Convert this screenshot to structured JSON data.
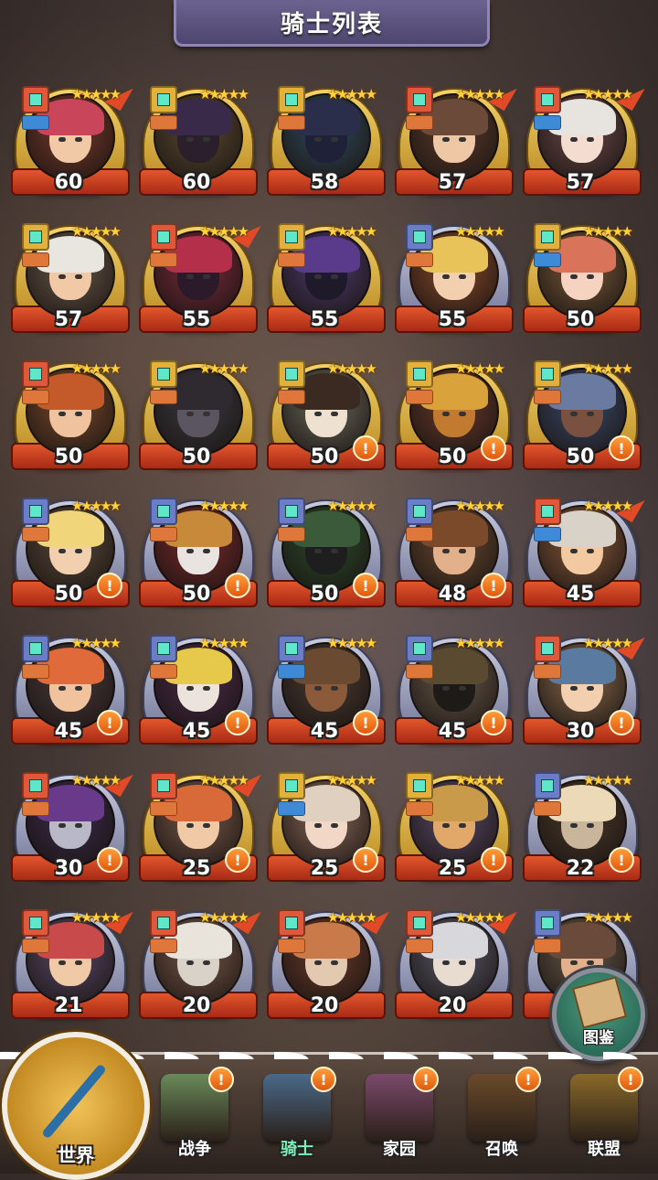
{
  "header": {
    "title": "骑士列表"
  },
  "knights": [
    {
      "level": "60",
      "frame": "gold",
      "tag": "t-red",
      "sub": "b-blue",
      "stars": "★★★★★",
      "up": true,
      "alert": false,
      "hair": "#c9455a",
      "skin": "#f1c9a6",
      "bg": "#7a3a2a"
    },
    {
      "level": "60",
      "frame": "gold",
      "tag": "t-gold",
      "sub": "b-orange",
      "stars": "★★★★★",
      "up": false,
      "alert": false,
      "hair": "#3a2a4a",
      "skin": "#2a1f2a",
      "bg": "#5b4a30"
    },
    {
      "level": "58",
      "frame": "gold",
      "tag": "t-gold",
      "sub": "b-orange",
      "stars": "★★★★★",
      "up": false,
      "alert": false,
      "hair": "#2a2e4a",
      "skin": "#1e2138",
      "bg": "#2e4a5a"
    },
    {
      "level": "57",
      "frame": "gold",
      "tag": "t-red",
      "sub": "b-orange",
      "stars": "★★★★★",
      "up": true,
      "alert": false,
      "hair": "#6b4a3a",
      "skin": "#eec7a5",
      "bg": "#5a3a2a"
    },
    {
      "level": "57",
      "frame": "gold",
      "tag": "t-red",
      "sub": "b-blue",
      "stars": "★★★★★",
      "up": true,
      "alert": false,
      "hair": "#e7e4df",
      "skin": "#f4ddd0",
      "bg": "#6b4a4a"
    },
    {
      "level": "57",
      "frame": "gold",
      "tag": "t-gold",
      "sub": "b-orange",
      "stars": "★★★★★",
      "up": false,
      "alert": false,
      "hair": "#e9e6e0",
      "skin": "#f1c9a6",
      "bg": "#6a5a4a"
    },
    {
      "level": "55",
      "frame": "gold",
      "tag": "t-red",
      "sub": "b-orange",
      "stars": "★★★★★",
      "up": true,
      "alert": false,
      "hair": "#b32f4a",
      "skin": "#2a1a2a",
      "bg": "#7a2a3a"
    },
    {
      "level": "55",
      "frame": "gold",
      "tag": "t-gold",
      "sub": "b-orange",
      "stars": "★★★★★",
      "up": false,
      "alert": false,
      "hair": "#5a3a8a",
      "skin": "#1e1a2a",
      "bg": "#4a3a6a"
    },
    {
      "level": "55",
      "frame": "silver",
      "tag": "t-blue",
      "sub": "b-orange",
      "stars": "★★★★★",
      "up": false,
      "alert": false,
      "hair": "#e8c35a",
      "skin": "#f2cfae",
      "bg": "#8a4a2a"
    },
    {
      "level": "50",
      "frame": "gold",
      "tag": "t-gold",
      "sub": "b-blue",
      "stars": "★★★★★",
      "up": false,
      "alert": false,
      "hair": "#d9745a",
      "skin": "#f6d3c0",
      "bg": "#7a5a3a"
    },
    {
      "level": "50",
      "frame": "gold",
      "tag": "t-red",
      "sub": "b-orange",
      "stars": "★★★★★",
      "up": false,
      "alert": false,
      "hair": "#c45a2a",
      "skin": "#f0c39e",
      "bg": "#7a4a2a"
    },
    {
      "level": "50",
      "frame": "gold",
      "tag": "t-gold",
      "sub": "b-orange",
      "stars": "★★★★★",
      "up": false,
      "alert": false,
      "hair": "#2e2a30",
      "skin": "#5a5560",
      "bg": "#3a3a40"
    },
    {
      "level": "50",
      "frame": "gold",
      "tag": "t-gold",
      "sub": "b-orange",
      "stars": "★★★★★",
      "up": false,
      "alert": true,
      "hair": "#3a2a22",
      "skin": "#efe1cf",
      "bg": "#6a6a5a"
    },
    {
      "level": "50",
      "frame": "gold",
      "tag": "t-gold",
      "sub": "b-orange",
      "stars": "★★★★★",
      "up": false,
      "alert": true,
      "hair": "#d9a23a",
      "skin": "#c27a30",
      "bg": "#6a3a2a"
    },
    {
      "level": "50",
      "frame": "gold",
      "tag": "t-gold",
      "sub": "b-orange",
      "stars": "★★★★★",
      "up": false,
      "alert": true,
      "hair": "#6a7aa0",
      "skin": "#7a5040",
      "bg": "#3a4a6a"
    },
    {
      "level": "50",
      "frame": "silver",
      "tag": "t-blue",
      "sub": "b-orange",
      "stars": "★★★★★",
      "up": false,
      "alert": true,
      "hair": "#f0d57a",
      "skin": "#f2cfae",
      "bg": "#5a4a3a"
    },
    {
      "level": "50",
      "frame": "silver",
      "tag": "t-blue",
      "sub": "b-orange",
      "stars": "★★★★★",
      "up": false,
      "alert": true,
      "hair": "#c78a3a",
      "skin": "#e9e4df",
      "bg": "#7a2a2a"
    },
    {
      "level": "50",
      "frame": "silver",
      "tag": "t-blue",
      "sub": "b-orange",
      "stars": "★★★★★",
      "up": false,
      "alert": true,
      "hair": "#3a5a3a",
      "skin": "#1e1e1e",
      "bg": "#2a4a2a"
    },
    {
      "level": "48",
      "frame": "silver",
      "tag": "t-blue",
      "sub": "b-orange",
      "stars": "★★★★★",
      "up": false,
      "alert": true,
      "hair": "#7a4a2a",
      "skin": "#e2b08a",
      "bg": "#6a4a30"
    },
    {
      "level": "45",
      "frame": "silver",
      "tag": "t-red",
      "sub": "b-blue",
      "stars": "★★★★★",
      "up": true,
      "alert": false,
      "hair": "#d8d2c8",
      "skin": "#f2c9a0",
      "bg": "#8a5a3a"
    },
    {
      "level": "45",
      "frame": "silver",
      "tag": "t-blue",
      "sub": "b-orange",
      "stars": "★★★★★",
      "up": false,
      "alert": true,
      "hair": "#e06a3a",
      "skin": "#f0c39e",
      "bg": "#4a3a3a"
    },
    {
      "level": "45",
      "frame": "silver",
      "tag": "t-blue",
      "sub": "b-orange",
      "stars": "★★★★★",
      "up": false,
      "alert": true,
      "hair": "#e6c84a",
      "skin": "#ece4dc",
      "bg": "#4a2a4a"
    },
    {
      "level": "45",
      "frame": "silver",
      "tag": "t-blue",
      "sub": "b-blue",
      "stars": "★★★★★",
      "up": false,
      "alert": true,
      "hair": "#6a4a30",
      "skin": "#8a5a3a",
      "bg": "#4a3a30"
    },
    {
      "level": "45",
      "frame": "silver",
      "tag": "t-blue",
      "sub": "b-orange",
      "stars": "★★★★★",
      "up": false,
      "alert": true,
      "hair": "#5a4a30",
      "skin": "#1e1a18",
      "bg": "#6a5a4a"
    },
    {
      "level": "30",
      "frame": "silver",
      "tag": "t-red",
      "sub": "b-orange",
      "stars": "★★★★★",
      "up": true,
      "alert": true,
      "hair": "#5a7aa0",
      "skin": "#f2cfae",
      "bg": "#8a6a4a"
    },
    {
      "level": "30",
      "frame": "silver",
      "tag": "t-red",
      "sub": "b-orange",
      "stars": "★★★★★",
      "up": true,
      "alert": true,
      "hair": "#6a3a8a",
      "skin": "#b8b8c8",
      "bg": "#3a2a4a"
    },
    {
      "level": "25",
      "frame": "gold",
      "tag": "t-red",
      "sub": "b-orange",
      "stars": "★★★★★",
      "up": true,
      "alert": true,
      "hair": "#d86a3a",
      "skin": "#f0c9a6",
      "bg": "#7a5a4a"
    },
    {
      "level": "25",
      "frame": "gold",
      "tag": "t-gold",
      "sub": "b-blue",
      "stars": "★★★★★",
      "up": false,
      "alert": true,
      "hair": "#e0d0c0",
      "skin": "#f2d6c6",
      "bg": "#8a6a5a"
    },
    {
      "level": "25",
      "frame": "gold",
      "tag": "t-gold",
      "sub": "b-orange",
      "stars": "★★★★★",
      "up": false,
      "alert": true,
      "hair": "#c89a4a",
      "skin": "#e1a86a",
      "bg": "#5a4a6a"
    },
    {
      "level": "22",
      "frame": "silver",
      "tag": "t-blue",
      "sub": "b-orange",
      "stars": "★★★★★",
      "up": false,
      "alert": true,
      "hair": "#ecd9b8",
      "skin": "#c9b59a",
      "bg": "#4a3a2a"
    },
    {
      "level": "21",
      "frame": "silver",
      "tag": "t-red",
      "sub": "b-orange",
      "stars": "★★★★★",
      "up": true,
      "alert": false,
      "hair": "#c84a4a",
      "skin": "#f0c9a6",
      "bg": "#5a4a6a"
    },
    {
      "level": "20",
      "frame": "silver",
      "tag": "t-red",
      "sub": "b-orange",
      "stars": "★★★★★",
      "up": true,
      "alert": false,
      "hair": "#e8e4dc",
      "skin": "#d9d2c9",
      "bg": "#7a5a4a"
    },
    {
      "level": "20",
      "frame": "silver",
      "tag": "t-red",
      "sub": "b-orange",
      "stars": "★★★★★",
      "up": true,
      "alert": false,
      "hair": "#c87a4a",
      "skin": "#e2c9b0",
      "bg": "#6a3a2a"
    },
    {
      "level": "20",
      "frame": "silver",
      "tag": "t-red",
      "sub": "b-orange",
      "stars": "★★★★★",
      "up": true,
      "alert": false,
      "hair": "#d8d8dc",
      "skin": "#e8dcd0",
      "bg": "#5a5a6a"
    },
    {
      "level": "",
      "frame": "silver",
      "tag": "t-blue",
      "sub": "b-orange",
      "stars": "★★★★★",
      "up": false,
      "alert": false,
      "hair": "#6a4a3a",
      "skin": "#e2b08a",
      "bg": "#6a5a4a"
    }
  ],
  "collection_button": {
    "label": "图鉴"
  },
  "nav": {
    "world": "世界",
    "tabs": [
      {
        "label": "战争",
        "alert": "!",
        "color": "#6a8a5a",
        "active": false
      },
      {
        "label": "骑士",
        "alert": "!",
        "color": "#4a6a8a",
        "active": true
      },
      {
        "label": "家园",
        "alert": "!",
        "color": "#7a4a6a",
        "active": false
      },
      {
        "label": "召唤",
        "alert": "!",
        "color": "#6a4a2a",
        "active": false
      },
      {
        "label": "联盟",
        "alert": "!",
        "color": "#8a6a2a",
        "active": false
      }
    ]
  }
}
